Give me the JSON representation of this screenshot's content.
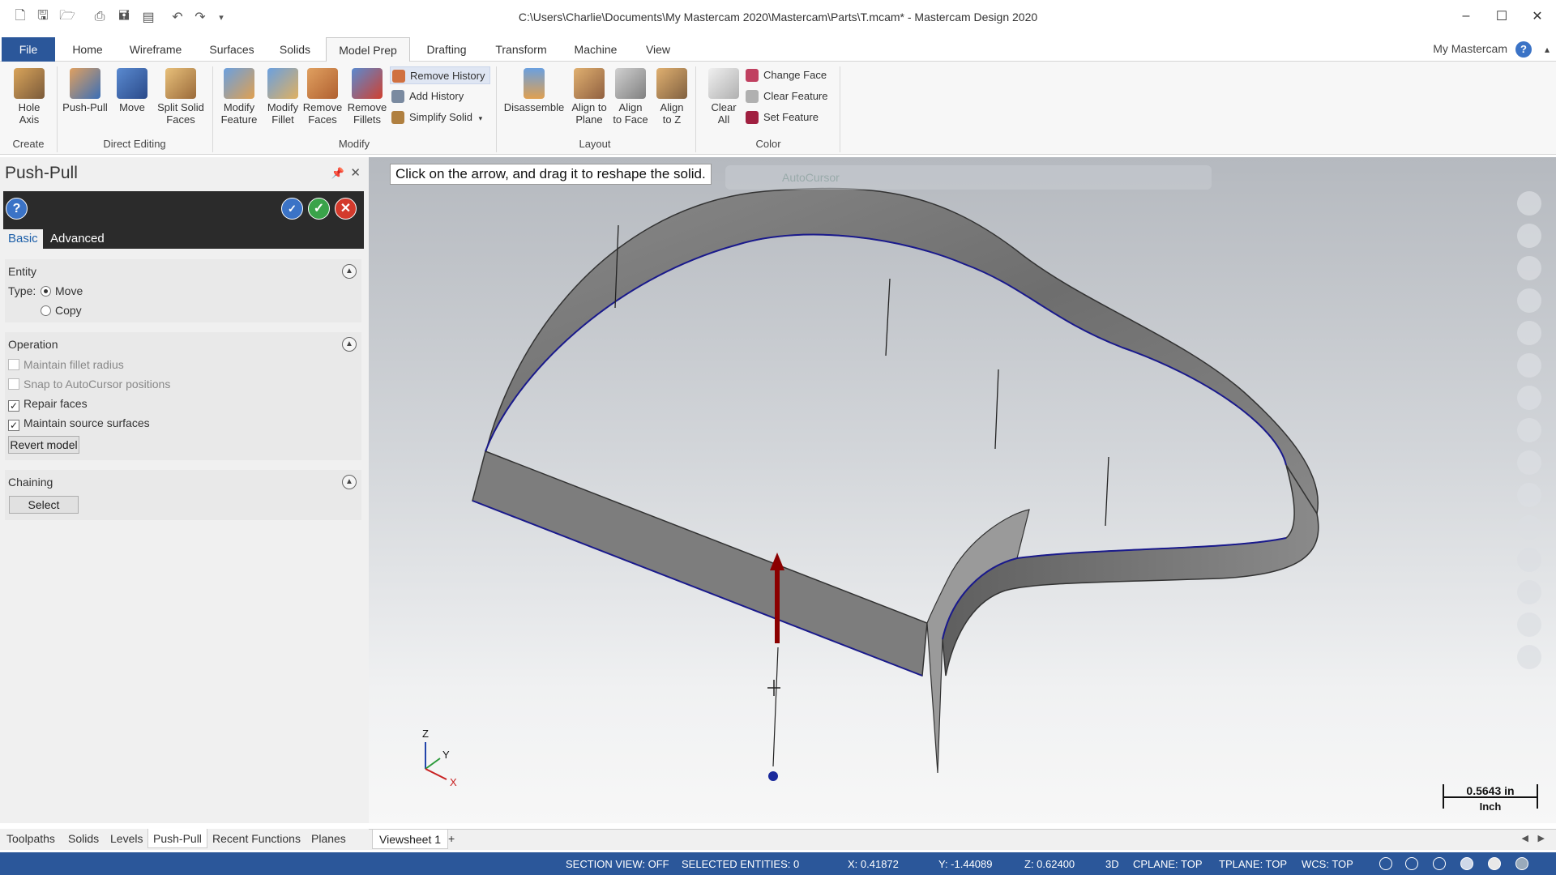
{
  "window": {
    "title": "C:\\Users\\Charlie\\Documents\\My Mastercam 2020\\Mastercam\\Parts\\T.mcam* - Mastercam Design 2020",
    "minimize": "–",
    "maximize": "☐",
    "close": "✕"
  },
  "ribbon_tabs": {
    "file": "File",
    "home": "Home",
    "wireframe": "Wireframe",
    "surfaces": "Surfaces",
    "solids": "Solids",
    "model_prep": "Model Prep",
    "drafting": "Drafting",
    "transform": "Transform",
    "machine": "Machine",
    "view": "View",
    "my_mastercam": "My Mastercam",
    "help": "?"
  },
  "ribbon": {
    "create": {
      "hole_axis": "Hole\nAxis",
      "label": "Create"
    },
    "direct_editing": {
      "push_pull": "Push-Pull",
      "move": "Move",
      "split_solid_faces": "Split Solid\nFaces",
      "label": "Direct Editing"
    },
    "modify": {
      "modify_feature": "Modify\nFeature",
      "modify_fillet": "Modify\nFillet",
      "remove_faces": "Remove\nFaces",
      "remove_fillets": "Remove\nFillets",
      "remove_history": "Remove History",
      "add_history": "Add History",
      "simplify_solid": "Simplify Solid",
      "label": "Modify"
    },
    "layout": {
      "disassemble": "Disassemble",
      "align_to_plane": "Align to\nPlane",
      "align_to_face": "Align\nto Face",
      "align_to_z": "Align\nto Z",
      "label": "Layout"
    },
    "color": {
      "clear_all": "Clear\nAll",
      "change_face": "Change Face",
      "clear_feature": "Clear Feature",
      "set_feature": "Set Feature",
      "label": "Color"
    }
  },
  "panel": {
    "title": "Push-Pull",
    "tabs": {
      "basic": "Basic",
      "advanced": "Advanced"
    },
    "entity": {
      "title": "Entity",
      "type_label": "Type:",
      "move": "Move",
      "copy": "Copy",
      "selected": "Move"
    },
    "operation": {
      "title": "Operation",
      "maintain_fillet_radius": "Maintain fillet radius",
      "snap_autocursor": "Snap to AutoCursor positions",
      "repair_faces": "Repair faces",
      "maintain_source_surfaces": "Maintain source surfaces",
      "revert_model": "Revert model"
    },
    "chaining": {
      "title": "Chaining",
      "select": "Select"
    }
  },
  "viewport": {
    "prompt": "Click on the arrow, and drag it to reshape the solid.",
    "autocursor": "AutoCursor",
    "axis_z": "Z",
    "axis_y": "Y",
    "axis_x": "X",
    "scale_value": "0.5643 in",
    "scale_unit": "Inch"
  },
  "bottom_tabs": {
    "toolpaths": "Toolpaths",
    "solids": "Solids",
    "levels": "Levels",
    "push_pull": "Push-Pull",
    "recent_functions": "Recent Functions",
    "planes": "Planes",
    "viewsheet": "Viewsheet 1",
    "add": "+"
  },
  "status": {
    "section_view": "SECTION VIEW: OFF",
    "selected_entities": "SELECTED ENTITIES: 0",
    "x": "X:  0.41872",
    "y": "Y:  -1.44089",
    "z": "Z:  0.62400",
    "mode": "3D",
    "cplane": "CPLANE: TOP",
    "tplane": "TPLANE: TOP",
    "wcs": "WCS: TOP"
  },
  "colors": {
    "accent": "#2b579a",
    "solid_face": "#7a7a7a",
    "edge": "#1a1a8c"
  }
}
